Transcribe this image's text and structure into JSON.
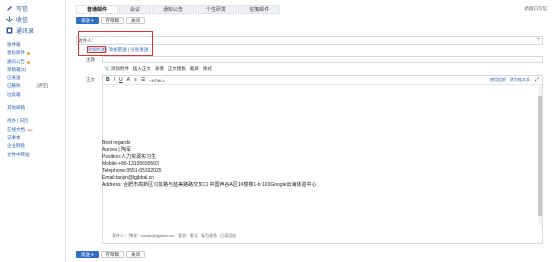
{
  "sidebar": {
    "write": "写信",
    "inbox": "收信",
    "contacts": "通讯录",
    "items": [
      {
        "label": "收件箱",
        "badge": ""
      },
      {
        "label": "星标邮件",
        "badge": "dot"
      },
      {
        "label": "通讯公告",
        "badge": "dot"
      },
      {
        "label": "草稿箱(3)",
        "badge": ""
      },
      {
        "label": "已发送",
        "badge": ""
      },
      {
        "label": "已删除",
        "badge": "[清空]"
      },
      {
        "label": "垃圾箱",
        "badge": ""
      },
      {
        "label": "",
        "badge": ""
      },
      {
        "label": "其他邮箱",
        "badge": ""
      },
      {
        "label": "",
        "badge": ""
      },
      {
        "label": "待办 | 日历",
        "badge": ""
      },
      {
        "label": "在线文档",
        "badge": "new"
      },
      {
        "label": "记事本",
        "badge": ""
      },
      {
        "label": "企业网盘",
        "badge": ""
      },
      {
        "label": "文件中转站",
        "badge": ""
      }
    ]
  },
  "tabs": [
    "普通邮件",
    "会议",
    "通知公告",
    "个性研发",
    "信笺邮件"
  ],
  "new_window": "新窗口写信",
  "toolbar": {
    "send": "发送",
    "save": "存草稿",
    "close": "关闭"
  },
  "compose": {
    "to_label": "收件人：",
    "add_cc": "添加抄送",
    "add_bcc": "添加密送",
    "separate": "分别发送",
    "subject_label": "主题",
    "body_label": "正文",
    "attach": "添加附件",
    "insert_text": "插入正文",
    "emoji": "表情",
    "paper": "正文模板",
    "screenshot": "截屏",
    "richtext": "格式",
    "use_paper": "使用信纸",
    "convert": "转为纯文本",
    "html_tag": "<HTML>"
  },
  "signature": [
    "Best regards",
    "Aurora | 陶军",
    "Position:人力资源实习生",
    "Mobile:+86-13195699503",
    "Telephone:0551-65332025",
    "Email:taojin@lgjbbal.cn",
    "Address: 合肥市高新区习友路与蓝美路路交叉口 中国声谷A区1#楼楼1-b 103Google出海体验中心"
  ],
  "footer": {
    "sender": "发件人：\"陶军\" <taojin@lgjbbal.cn>",
    "sign": "签名：默认",
    "urgent": "标为紧急",
    "receipt": "已读回执"
  }
}
